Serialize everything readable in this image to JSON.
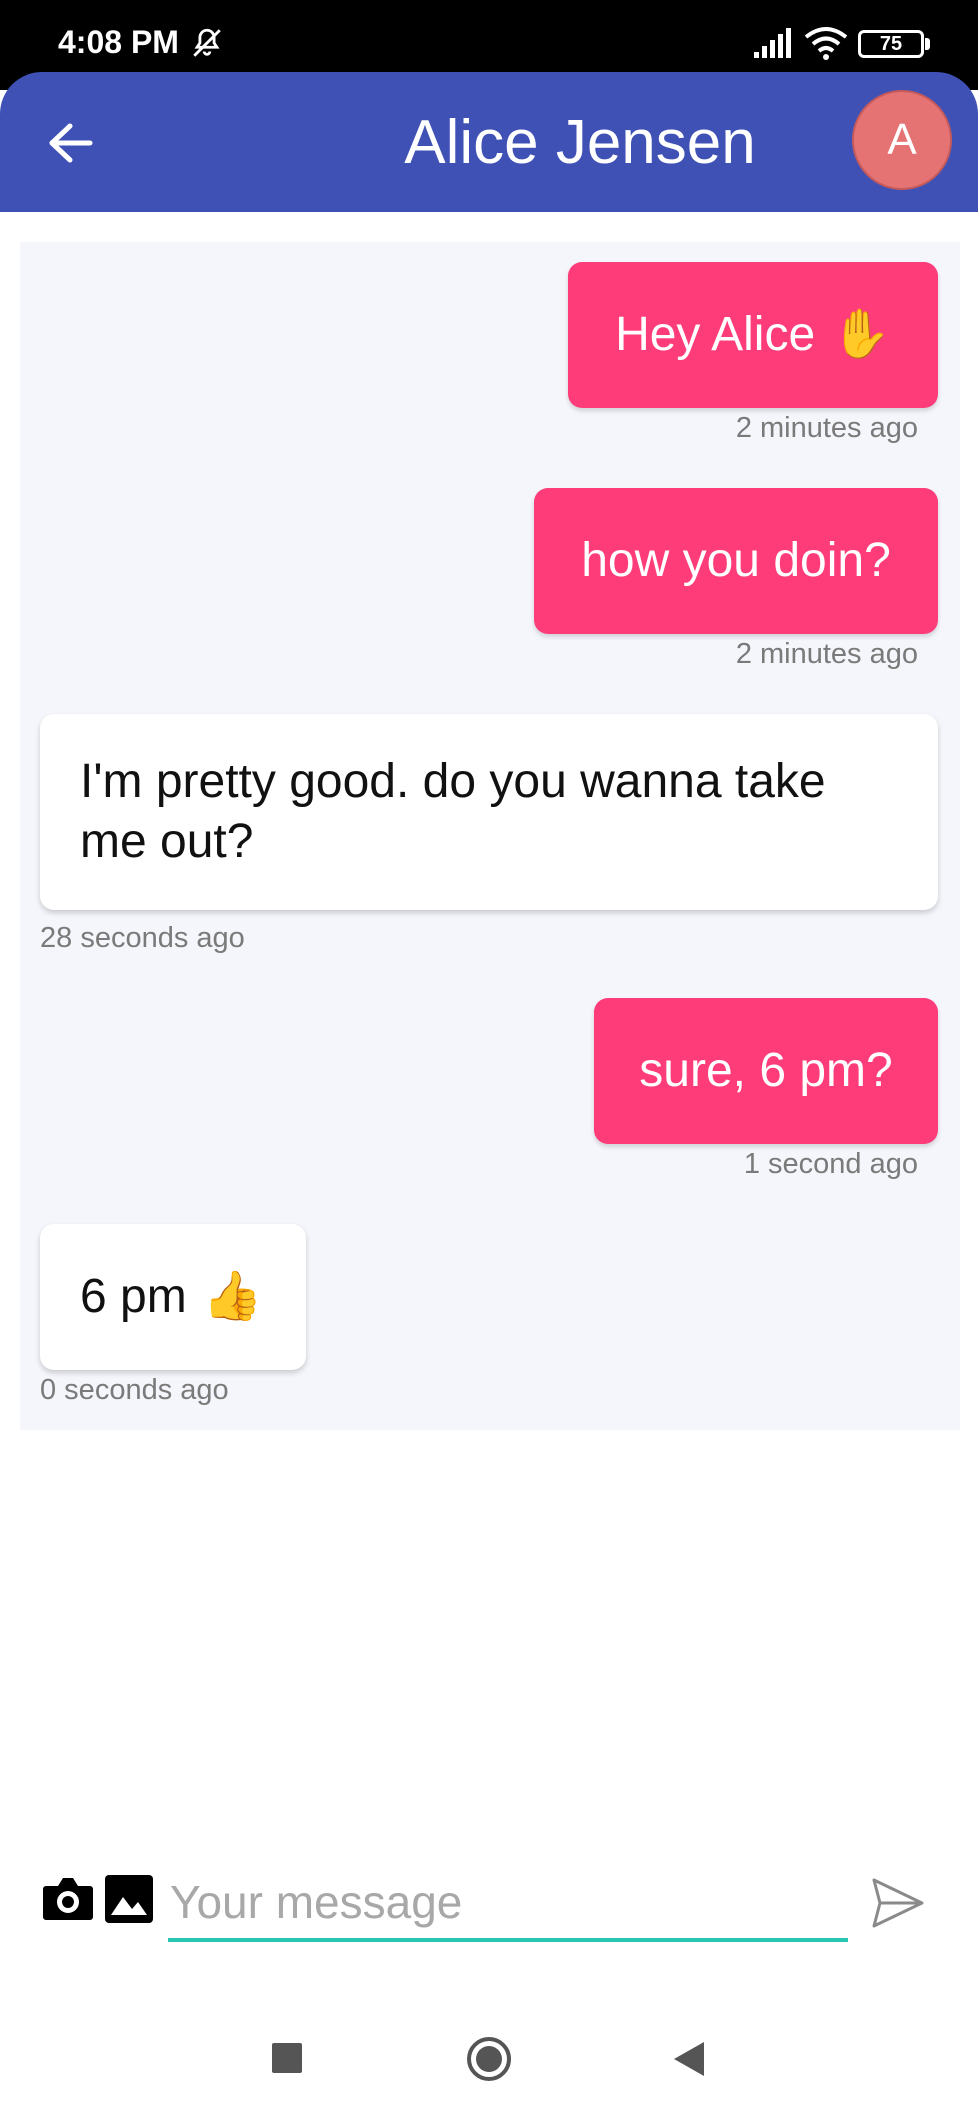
{
  "status_bar": {
    "time": "4:08 PM",
    "battery": "75"
  },
  "header": {
    "title": "Alice Jensen",
    "avatar_letter": "A"
  },
  "messages": [
    {
      "direction": "outgoing",
      "text": "Hey Alice",
      "emoji": "✋",
      "time": "2 minutes ago"
    },
    {
      "direction": "outgoing",
      "text": "how you doin?",
      "time": "2 minutes ago"
    },
    {
      "direction": "incoming",
      "text": "I'm pretty good. do you wanna take me out?",
      "time": "28 seconds ago"
    },
    {
      "direction": "outgoing",
      "text": "sure, 6 pm?",
      "time": "1 second ago"
    },
    {
      "direction": "incoming",
      "text": "6 pm",
      "emoji": "👍",
      "time": "0 seconds ago"
    }
  ],
  "composer": {
    "placeholder": "Your message",
    "value": ""
  },
  "colors": {
    "app_bar": "#3f51b5",
    "outgoing_bubble": "#fe3c7a",
    "avatar": "#e57373",
    "input_underline": "#26c6b0"
  }
}
